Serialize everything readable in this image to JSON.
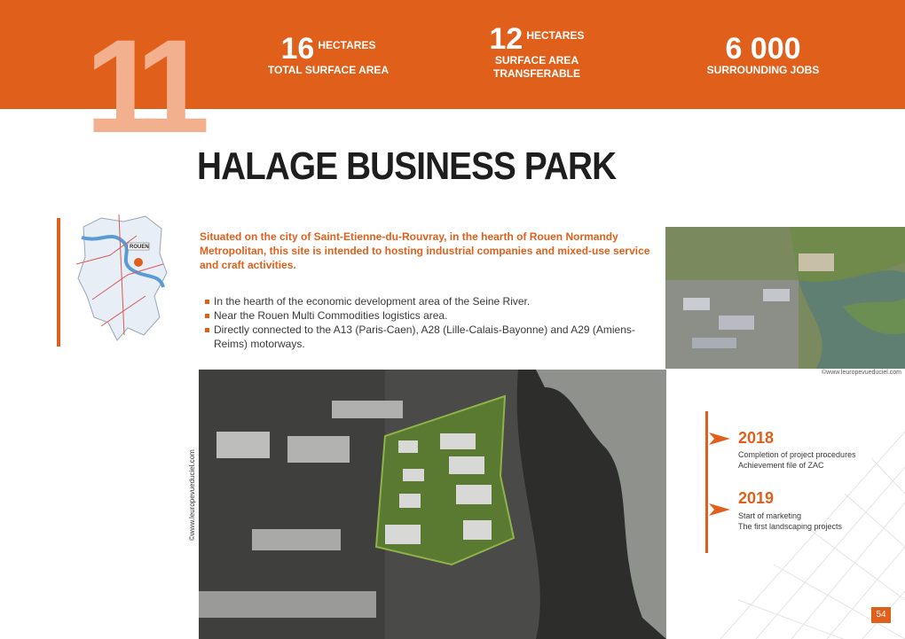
{
  "header": {
    "site_number": "11",
    "stats": [
      {
        "value": "16",
        "unit": "HECTARES",
        "label_lines": [
          "TOTAL SURFACE AREA"
        ]
      },
      {
        "value": "12",
        "unit": "HECTARES",
        "label_lines": [
          "SURFACE AREA",
          "TRANSFERABLE"
        ]
      },
      {
        "value": "6 000",
        "unit": "",
        "label_lines": [
          "SURROUNDING JOBS"
        ]
      }
    ]
  },
  "title": "HALAGE BUSINESS PARK",
  "map": {
    "city_label": "ROUEN"
  },
  "intro": "Situated on the city of Saint-Etienne-du-Rouvray, in the hearth of Rouen Normandy Metropolitan, this site is intended to hosting industrial companies and mixed-use service and craft activities.",
  "bullets": [
    "In the hearth of the economic development area of the Seine River.",
    "Near the Rouen Multi Commodities logistics area.",
    "Directly connected to the A13 (Paris-Caen), A28 (Lille-Calais-Bayonne) and A29 (Amiens-Reims) motorways."
  ],
  "credits": {
    "aerial": "©www.leuropevueduciel.com",
    "render": "©www.leuropevueduciel.com"
  },
  "timeline": [
    {
      "year": "2018",
      "lines": [
        "Completion of project procedures",
        "Achievement file of ZAC"
      ]
    },
    {
      "year": "2019",
      "lines": [
        "Start of marketing",
        "The first landscaping projects"
      ]
    }
  ],
  "page_number": "54",
  "colors": {
    "accent": "#e0601b",
    "accent_light": "#f2b08e"
  }
}
